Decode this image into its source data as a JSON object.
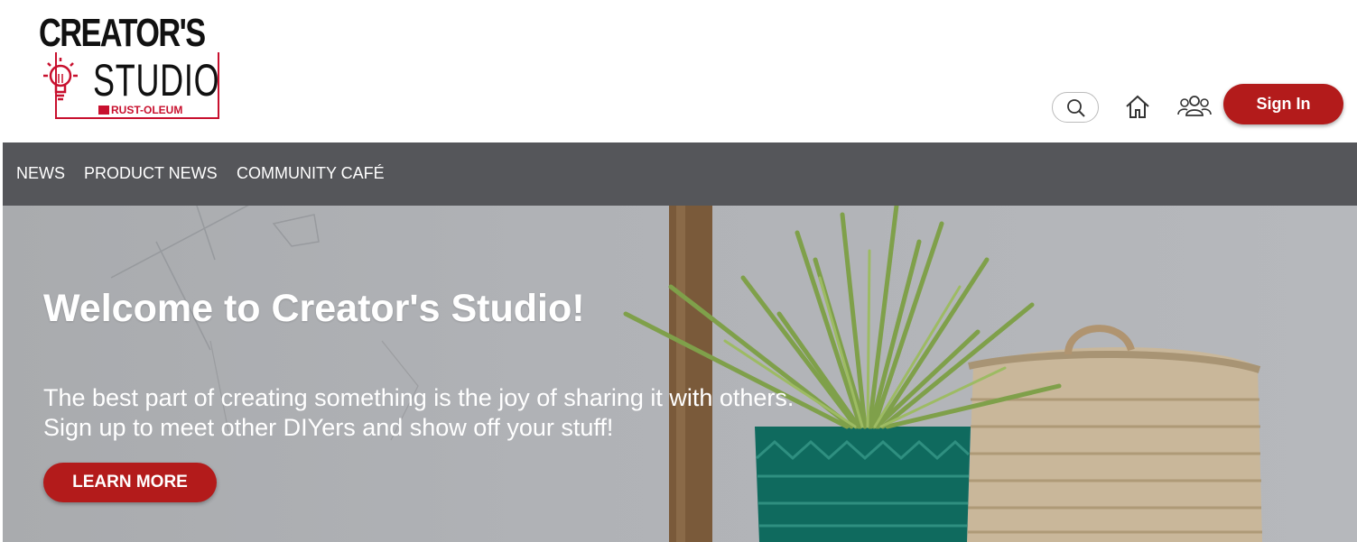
{
  "brand": {
    "line1": "CREATOR'S",
    "line2": "STUDIO",
    "byline": "RUST-OLEUM",
    "accent_color": "#c8102e"
  },
  "header": {
    "search_icon": "search-icon",
    "home_icon": "home-icon",
    "community_icon": "people-icon",
    "signin_label": "Sign In"
  },
  "nav": {
    "items": [
      "NEWS",
      "PRODUCT NEWS",
      "COMMUNITY CAFÉ"
    ],
    "background": "#55565a"
  },
  "hero": {
    "title": "Welcome to Creator's Studio!",
    "line1": "The best part of creating something is the joy of sharing it with others.",
    "line2": "Sign up to meet other DIYers and show off your stuff!",
    "cta_label": "LEARN MORE",
    "button_color": "#b31b1b"
  }
}
